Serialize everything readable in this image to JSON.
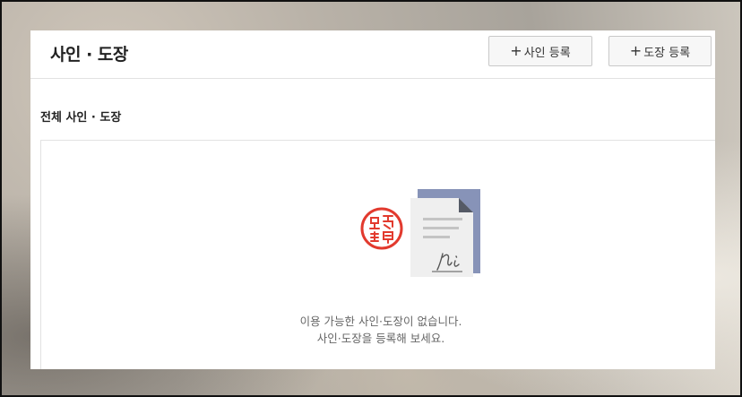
{
  "header": {
    "title": "사인 · 도장",
    "add_sign_plus": "+",
    "add_sign_label": "사인 등록",
    "add_stamp_plus": "+",
    "add_stamp_label": "도장 등록"
  },
  "section": {
    "title": "전체 사인 · 도장"
  },
  "empty_state": {
    "icon": "stamp-and-signed-document-icon",
    "line1": "이용 가능한 사인·도장이 없습니다.",
    "line2": "사인·도장을 등록해 보세요."
  },
  "colors": {
    "stamp_red": "#e23a2e",
    "doc_back": "#8793b8",
    "doc_front": "#efefef",
    "doc_lines": "#c4c4c4"
  }
}
